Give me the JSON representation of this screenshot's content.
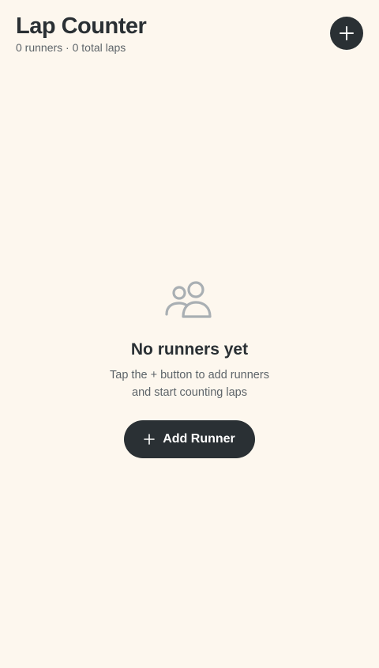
{
  "header": {
    "title": "Lap Counter",
    "subtitle": "0 runners · 0 total laps",
    "add_icon": "plus-icon"
  },
  "empty_state": {
    "icon": "users-icon",
    "title": "No runners yet",
    "desc_line1": "Tap the + button to add runners",
    "desc_line2": "and start counting laps",
    "button_label": "Add Runner",
    "button_icon": "plus-icon"
  },
  "colors": {
    "background": "#fdf7ee",
    "primary": "#2a3034",
    "muted_text": "#5d6469",
    "icon_muted": "#a9afb3"
  }
}
